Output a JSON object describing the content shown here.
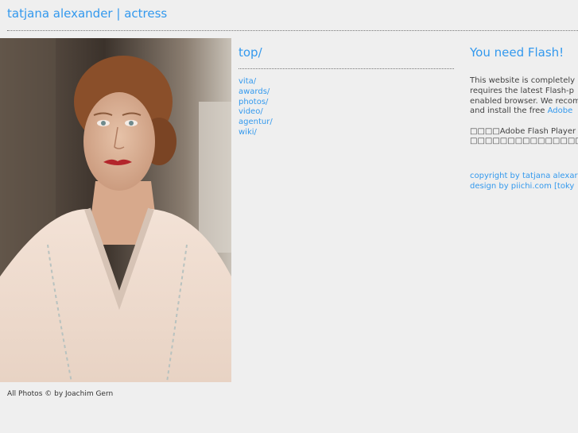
{
  "header": {
    "site_title": "tatjana alexander | actress"
  },
  "photo": {
    "credit": "All Photos © by Joachim Gern"
  },
  "nav": {
    "heading": "top/",
    "items": [
      {
        "label": "vita/"
      },
      {
        "label": "awards/"
      },
      {
        "label": "photos/"
      },
      {
        "label": "video/"
      },
      {
        "label": "agentur/"
      },
      {
        "label": "wiki/"
      }
    ]
  },
  "flash_notice": {
    "heading": "You need Flash!",
    "line1": "This website is completely",
    "line2": "requires the latest Flash-p",
    "line3": "enabled browser. We recom",
    "line4_prefix": "and install the free ",
    "line4_link": "Adobe",
    "jp_line1": "□□□□Adobe Flash Player □□",
    "jp_line2": "□□□□□□□□□□□□□□□□□□□□□□□□"
  },
  "footer": {
    "copyright": "copyright by tatjana alexar",
    "design": "design by piichi.com [toky"
  }
}
